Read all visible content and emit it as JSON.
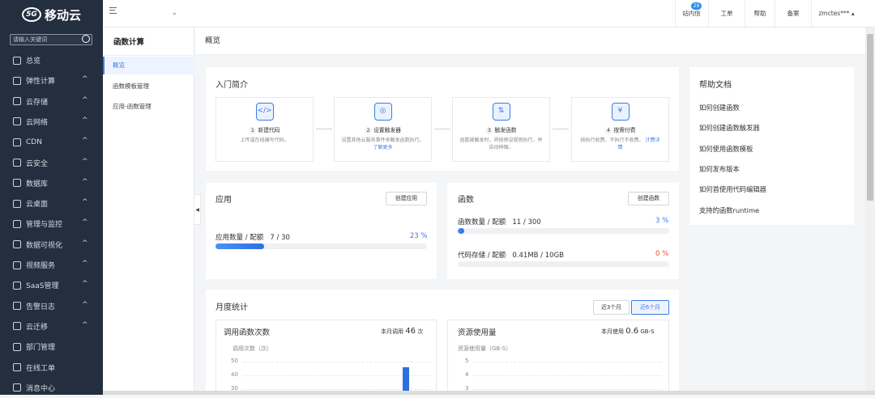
{
  "brand": {
    "logo_mark": "5G",
    "name": "移动云"
  },
  "search": {
    "placeholder": "请输入关键词"
  },
  "nav": [
    {
      "label": "总览",
      "chev": ""
    },
    {
      "label": "弹性计算",
      "chev": "^"
    },
    {
      "label": "云存储",
      "chev": "^"
    },
    {
      "label": "云网络",
      "chev": "^"
    },
    {
      "label": "CDN",
      "chev": "^"
    },
    {
      "label": "云安全",
      "chev": "^"
    },
    {
      "label": "数据库",
      "chev": "^"
    },
    {
      "label": "云桌面",
      "chev": "^"
    },
    {
      "label": "管理与监控",
      "chev": "^"
    },
    {
      "label": "数据可视化",
      "chev": "^"
    },
    {
      "label": "视频服务",
      "chev": "^"
    },
    {
      "label": "SaaS管理",
      "chev": "^"
    },
    {
      "label": "告警日志",
      "chev": "^"
    },
    {
      "label": "云迁移",
      "chev": "^"
    },
    {
      "label": "部门管理",
      "chev": ""
    },
    {
      "label": "在线工单",
      "chev": ""
    },
    {
      "label": "消息中心",
      "chev": ""
    }
  ],
  "topbar": {
    "badge": "29",
    "items": [
      "站内信",
      "工单",
      "帮助",
      "备案",
      "zmctes*** ▴"
    ]
  },
  "sub": {
    "title": "函数计算",
    "items": [
      "概览",
      "函数模板管理",
      "应用-函数管理"
    ]
  },
  "breadcrumb": "概览",
  "intro": {
    "title": "入门简介",
    "steps": [
      {
        "num": "1",
        "title": "新建代码",
        "desc": "上传或在线编写代码。",
        "link": ""
      },
      {
        "num": "2",
        "title": "设置触发器",
        "desc": "设置其他云服务事件来触发函数执行。",
        "link": "了解更多"
      },
      {
        "num": "3",
        "title": "触发函数",
        "desc": "函数被触发时，将按预设规则执行，并自动伸缩。",
        "link": ""
      },
      {
        "num": "4",
        "title": "按需付费",
        "desc": "按执行收费，不执行不收费。",
        "link": "计费详情"
      }
    ],
    "icons": [
      "</>",
      "◎",
      "⇅",
      "¥"
    ]
  },
  "apps": {
    "title": "应用",
    "button": "创建应用",
    "label": "应用数量 / 配额",
    "value": "7 / 30",
    "percent": "23 %",
    "fill": 0.23
  },
  "funcs": {
    "title": "函数",
    "button": "创建函数",
    "count_label": "函数数量 / 配额",
    "count_value": "11 / 300",
    "count_percent": "3 %",
    "count_fill": 0.03,
    "storage_label": "代码存储 / 配额",
    "storage_value": "0.41MB / 10GB",
    "storage_percent": "0 %",
    "storage_fill": 0.0
  },
  "colors": {
    "accent": "#3b7be9",
    "danger": "#e74c3c",
    "nav_bg": "#232e3e"
  },
  "help": {
    "title": "帮助文档",
    "links": [
      "如何创建函数",
      "如何创建函数触发器",
      "如何使用函数模板",
      "如何发布版本",
      "如何首使用代码编辑器",
      "支持的函数runtime"
    ]
  },
  "monthly": {
    "title": "月度统计",
    "range_buttons": [
      "近3个月",
      "近6个月"
    ],
    "invocations": {
      "title": "调用函数次数",
      "summary_prefix": "本月调用",
      "summary_value": "46",
      "summary_unit": "次",
      "axis_label": "调用次数（次）",
      "yticks": [
        "50",
        "40",
        "30"
      ]
    },
    "resources": {
      "title": "资源使用量",
      "summary_prefix": "本月使用",
      "summary_value": "0.6",
      "summary_unit": "GB-S",
      "axis_label": "资源使用量（GB-S）",
      "yticks": [
        "5",
        "4",
        "3"
      ]
    }
  },
  "chart_data": [
    {
      "type": "bar",
      "title": "调用函数次数",
      "ylabel": "调用次数（次）",
      "ylim": [
        0,
        50
      ],
      "yticks": [
        50,
        40,
        30
      ],
      "values": [
        46
      ]
    },
    {
      "type": "bar",
      "title": "资源使用量",
      "ylabel": "资源使用量（GB-S）",
      "ylim": [
        0,
        5
      ],
      "yticks": [
        5,
        4,
        3
      ],
      "values": []
    }
  ]
}
